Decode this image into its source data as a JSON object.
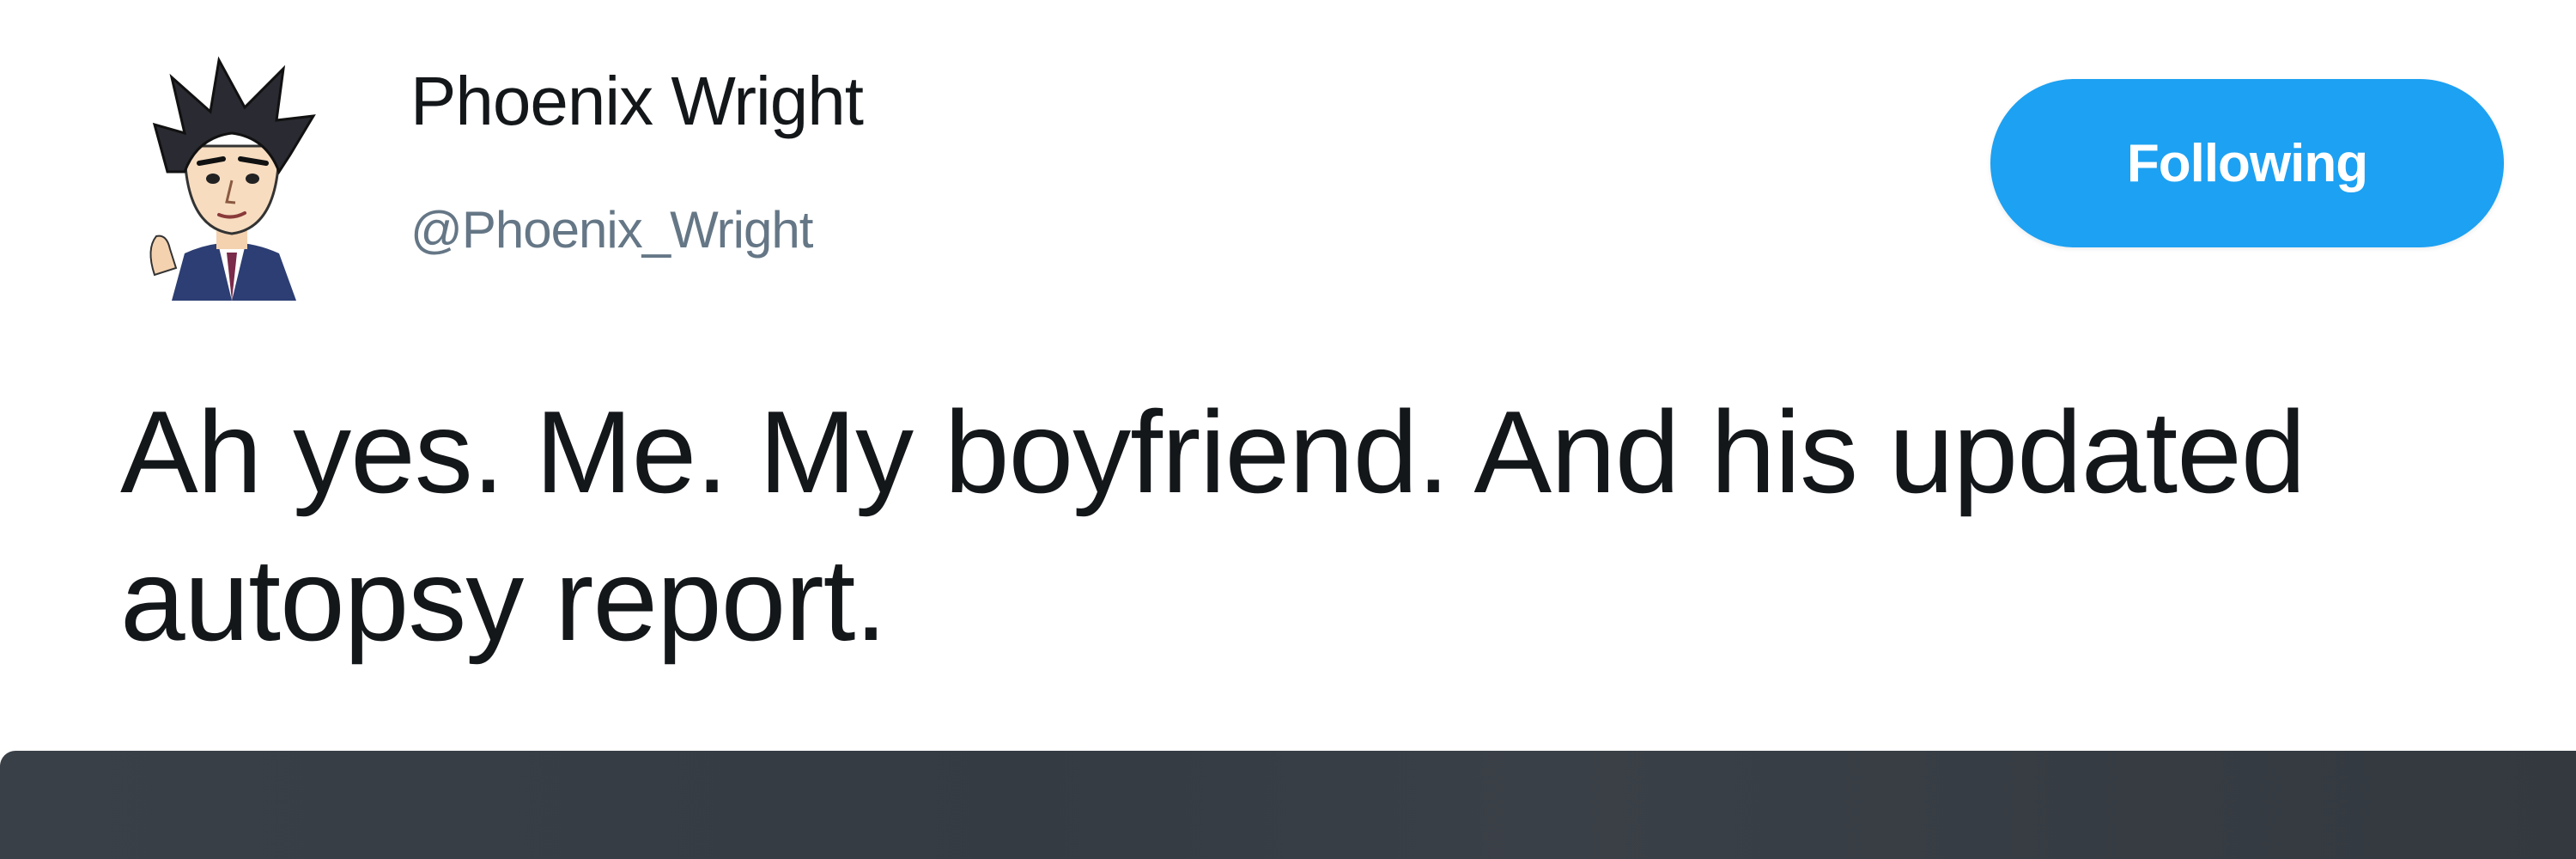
{
  "tweet": {
    "user": {
      "display_name": "Phoenix Wright",
      "handle": "@Phoenix_Wright",
      "avatar_icon": "character-avatar-icon"
    },
    "follow_button": {
      "label": "Following",
      "color": "#1da1f2"
    },
    "text": "Ah yes. Me. My boyfriend. And his updated autopsy report."
  },
  "colors": {
    "name_text": "#14171a",
    "handle_text": "#657786",
    "media_background": "#3a4048"
  }
}
